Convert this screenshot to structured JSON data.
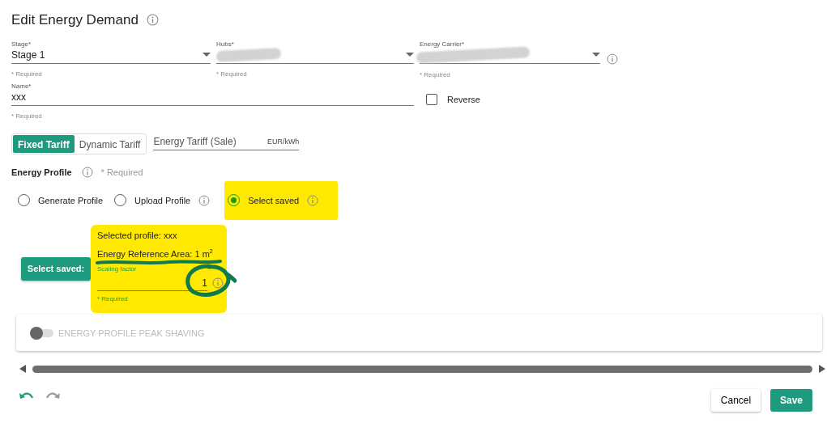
{
  "title": "Edit Energy Demand",
  "selects": [
    {
      "label": "Stage*",
      "value": "Stage 1",
      "hint": "* Required",
      "redacted": false,
      "info": false
    },
    {
      "label": "Hubs*",
      "hint": "* Required",
      "redacted": true,
      "info": false
    },
    {
      "label": "Energy Carrier*",
      "hint": "* Required",
      "redacted": true,
      "info": true
    }
  ],
  "name_field": {
    "label": "Name*",
    "value": "xxx",
    "hint": "* Required"
  },
  "reverse": {
    "label": "Reverse",
    "checked": false
  },
  "tariff_modes": [
    {
      "label": "Fixed Tariff",
      "selected": true
    },
    {
      "label": "Dynamic Tariff",
      "selected": false
    }
  ],
  "tariff_field": {
    "placeholder": "Energy Tariff (Sale)",
    "unit": "EUR/kWh"
  },
  "energy_profile": {
    "title": "Energy Profile",
    "hint": "* Required"
  },
  "profile_sources": [
    {
      "label": "Generate Profile",
      "selected": false,
      "info": false,
      "highlighted": false
    },
    {
      "label": "Upload Profile",
      "selected": false,
      "info": true,
      "highlighted": false
    },
    {
      "label": "Select saved",
      "selected": true,
      "info": true,
      "highlighted": true
    }
  ],
  "saved": {
    "button": "Select saved:",
    "selected_profile": "Selected profile: xxx",
    "area": "Energy Reference Area: 1 m$^{2}$",
    "area_underlined": true,
    "scaling_label": "Scaling factor",
    "scaling_value": "1",
    "scaling_circled": true,
    "hint": "* Required",
    "highlighted": true
  },
  "peak_shaving": {
    "label": "ENERGY PROFILE PEAK SHAVING",
    "on": false
  },
  "footer": {
    "cancel": "Cancel",
    "save": "Save"
  }
}
